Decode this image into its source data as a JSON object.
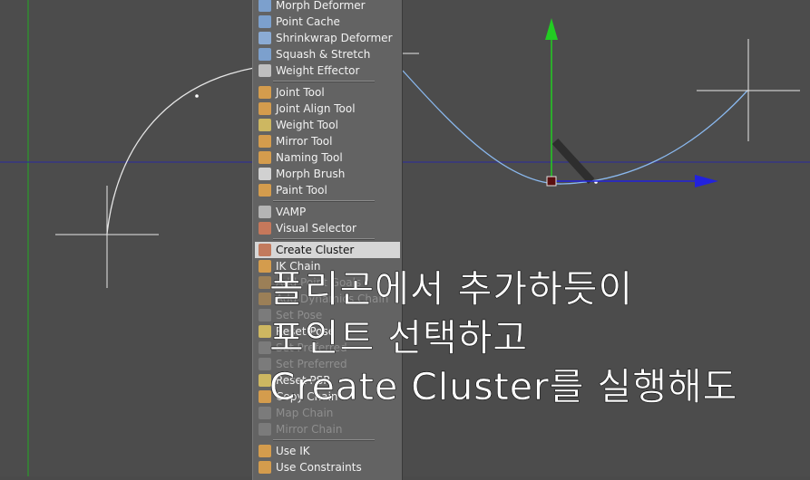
{
  "menu": {
    "items": [
      {
        "label": "Morph Deformer",
        "icon": "morph-deformer-icon",
        "color": "#7ea6d8",
        "state": "normal",
        "sep_after": false
      },
      {
        "label": "Point Cache",
        "icon": "point-cache-icon",
        "color": "#7ea6d8",
        "state": "normal",
        "sep_after": false
      },
      {
        "label": "Shrinkwrap Deformer",
        "icon": "shrinkwrap-deformer-icon",
        "color": "#8fb3e0",
        "state": "normal",
        "sep_after": false
      },
      {
        "label": "Squash & Stretch",
        "icon": "squash-stretch-icon",
        "color": "#7ea6d8",
        "state": "normal",
        "sep_after": false
      },
      {
        "label": "Weight Effector",
        "icon": "weight-effector-icon",
        "color": "#c9c9c9",
        "state": "normal",
        "sep_after": true
      },
      {
        "label": "Joint Tool",
        "icon": "joint-tool-icon",
        "color": "#e0a24a",
        "state": "normal",
        "sep_after": false
      },
      {
        "label": "Joint Align Tool",
        "icon": "joint-align-tool-icon",
        "color": "#e0a24a",
        "state": "normal",
        "sep_after": false
      },
      {
        "label": "Weight Tool",
        "icon": "weight-tool-icon",
        "color": "#d8c060",
        "state": "normal",
        "sep_after": false
      },
      {
        "label": "Mirror Tool",
        "icon": "mirror-tool-icon",
        "color": "#e0a24a",
        "state": "normal",
        "sep_after": false
      },
      {
        "label": "Naming Tool",
        "icon": "naming-tool-icon",
        "color": "#e0a24a",
        "state": "normal",
        "sep_after": false
      },
      {
        "label": "Morph Brush",
        "icon": "morph-brush-icon",
        "color": "#dddddd",
        "state": "normal",
        "sep_after": false
      },
      {
        "label": "Paint Tool",
        "icon": "paint-tool-icon",
        "color": "#e0a24a",
        "state": "normal",
        "sep_after": true
      },
      {
        "label": "VAMP",
        "icon": "vamp-icon",
        "color": "#bdbdbd",
        "state": "normal",
        "sep_after": false
      },
      {
        "label": "Visual Selector",
        "icon": "visual-selector-icon",
        "color": "#d07a5a",
        "state": "normal",
        "sep_after": true
      },
      {
        "label": "Create Cluster",
        "icon": "create-cluster-icon",
        "color": "#c07050",
        "state": "selected",
        "sep_after": false
      },
      {
        "label": "IK Chain",
        "icon": "ik-chain-icon",
        "color": "#e0a24a",
        "state": "normal",
        "sep_after": false
      },
      {
        "label": "Add Point Goals",
        "icon": "add-point-goals-icon",
        "color": "#e0a24a",
        "state": "disabled",
        "sep_after": false
      },
      {
        "label": "Add Dynamics Chain",
        "icon": "add-dynamics-chain-icon",
        "color": "#e0a24a",
        "state": "disabled",
        "sep_after": false
      },
      {
        "label": "Set Pose",
        "icon": "set-pose-icon",
        "color": "#999999",
        "state": "disabled",
        "sep_after": false
      },
      {
        "label": "Reset Pose",
        "icon": "reset-pose-icon",
        "color": "#d8c060",
        "state": "normal",
        "sep_after": false
      },
      {
        "label": "Set Preferred",
        "icon": "set-preferred-icon",
        "color": "#999999",
        "state": "disabled",
        "sep_after": false
      },
      {
        "label": "Set Preferred",
        "icon": "set-preferred-icon-2",
        "color": "#999999",
        "state": "disabled",
        "sep_after": false
      },
      {
        "label": "Reset PSR",
        "icon": "reset-psr-icon",
        "color": "#d8c060",
        "state": "normal",
        "sep_after": false
      },
      {
        "label": "Copy Chain",
        "icon": "copy-chain-icon",
        "color": "#e0a24a",
        "state": "normal",
        "sep_after": false
      },
      {
        "label": "Map Chain",
        "icon": "map-chain-icon",
        "color": "#999999",
        "state": "disabled",
        "sep_after": false
      },
      {
        "label": "Mirror Chain",
        "icon": "mirror-chain-icon",
        "color": "#999999",
        "state": "disabled",
        "sep_after": true
      },
      {
        "label": "Use IK",
        "icon": "use-ik-icon",
        "color": "#e0a24a",
        "state": "normal",
        "sep_after": false
      },
      {
        "label": "Use Constraints",
        "icon": "use-constraints-icon",
        "color": "#e0a24a",
        "state": "normal",
        "sep_after": false
      }
    ]
  },
  "caption": {
    "line1": "폴리곤에서 추가하듯이",
    "line2": "포인트 선택하고",
    "line3": "Create Cluster를 실행해도"
  },
  "colors": {
    "viewport_bg": "#4c4c4c",
    "spline_white": "#e6e6e6",
    "spline_blue": "#8ab8ee",
    "axis_y": "#22cc22",
    "axis_x": "#2222dd",
    "horizon": "#2a2aa0",
    "menu_bg": "#636363",
    "menu_selected": "#d6d6d6"
  }
}
